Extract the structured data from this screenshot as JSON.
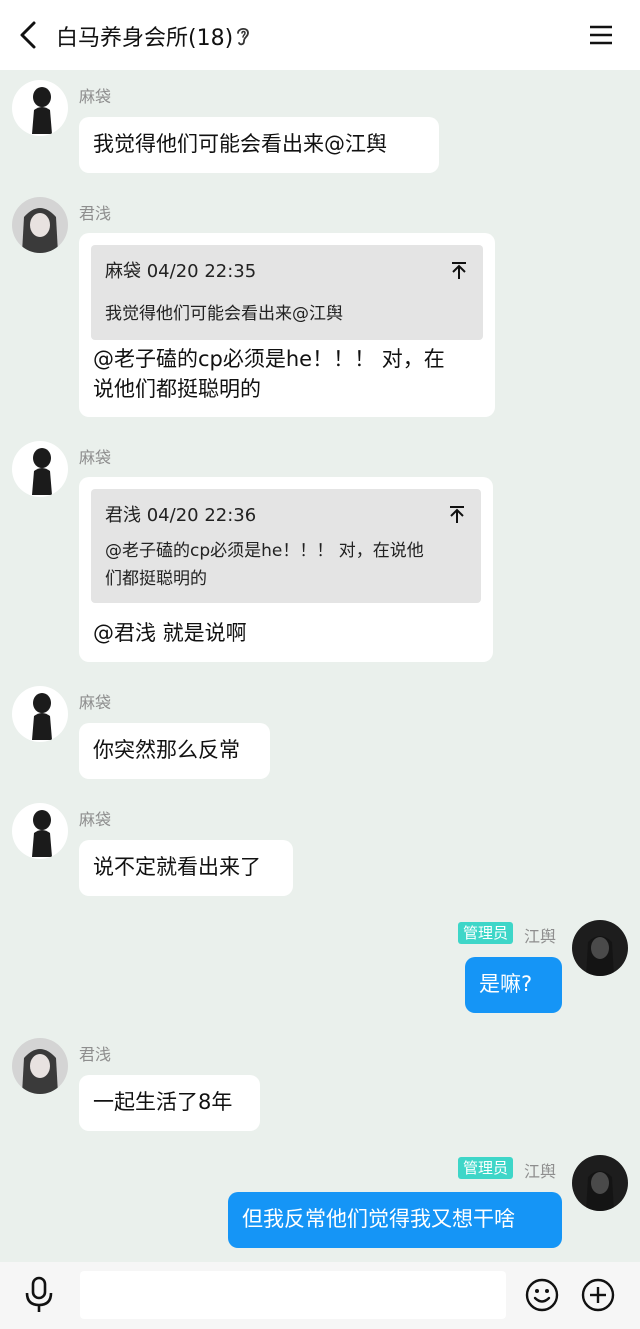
{
  "header": {
    "title": "白马养身会所(18)",
    "back_icon": "chevron-left-icon",
    "ear_icon": "ear-icon",
    "menu_icon": "hamburger-menu-icon"
  },
  "badge_label": "管理员",
  "messages": [
    {
      "sender": "麻袋",
      "text": "我觉得他们可能会看出来@江舆"
    },
    {
      "sender": "君浅",
      "quote_header": "麻袋 04/20 22:35",
      "quote_text": "我觉得他们可能会看出来@江舆",
      "lines": [
        "@老子磕的cp必须是he！！！ 对，在",
        "说他们都挺聪明的"
      ]
    },
    {
      "sender": "麻袋",
      "quote_header": "君浅 04/20 22:36",
      "quote_lines": [
        "@老子磕的cp必须是he！！！ 对，在说他",
        "们都挺聪明的"
      ],
      "text": "@君浅 就是说啊"
    },
    {
      "sender": "麻袋",
      "text": "你突然那么反常"
    },
    {
      "sender": "麻袋",
      "text": "说不定就看出来了"
    },
    {
      "sender": "江舆",
      "text": "是嘛?"
    },
    {
      "sender": "君浅",
      "text": "一起生活了8年"
    },
    {
      "sender": "江舆",
      "text": "但我反常他们觉得我又想干啥"
    }
  ],
  "bottom_bar": {
    "input_value": "",
    "mic_icon": "microphone-icon",
    "emoji_icon": "smiley-icon",
    "plus_icon": "plus-circle-icon"
  },
  "colors": {
    "background": "#eaf0ec",
    "self_bubble": "#1595f6",
    "other_bubble": "#ffffff",
    "admin_badge": "#3ed6c8",
    "quote_box": "#e4e4e4"
  }
}
